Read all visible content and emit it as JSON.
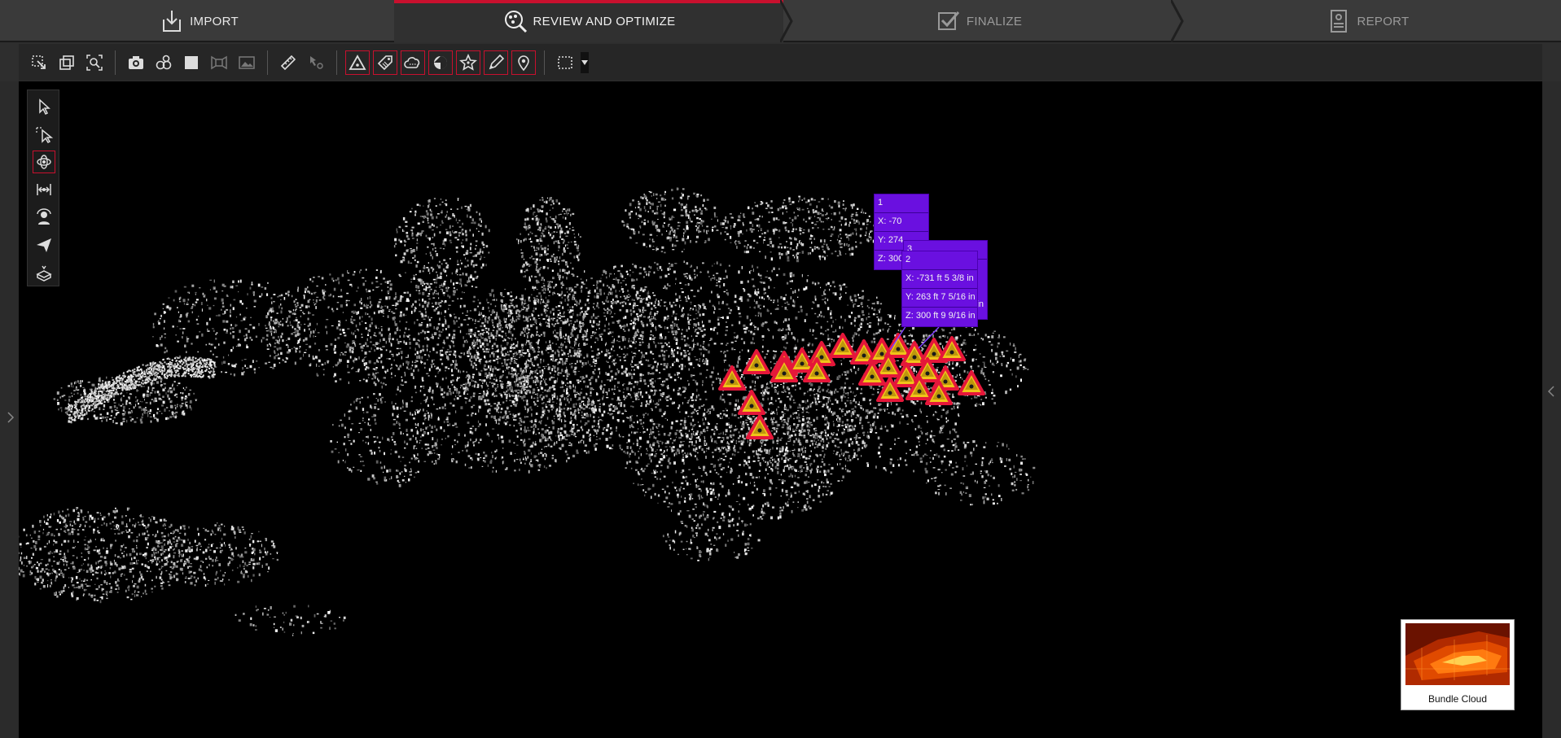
{
  "workflow": {
    "steps": [
      {
        "label": "IMPORT",
        "icon": "import-icon",
        "state": "done"
      },
      {
        "label": "REVIEW AND OPTIMIZE",
        "icon": "review-icon",
        "state": "active"
      },
      {
        "label": "FINALIZE",
        "icon": "finalize-icon",
        "state": "inactive"
      },
      {
        "label": "REPORT",
        "icon": "report-icon",
        "state": "inactive"
      }
    ],
    "active_color": "#c8102e"
  },
  "toolbar": {
    "groups": [
      [
        "fit-selection-icon",
        "clip-box-icon",
        "zoom-extents-icon"
      ],
      [
        "camera-icon",
        "scan-positions-icon",
        "box-view-icon",
        "panorama-view-icon",
        "image-icon"
      ],
      [
        "measure-icon",
        "pick-point-icon"
      ],
      [
        "warning-marker-icon",
        "tag-icon",
        "cloud-icon",
        "target-icon",
        "star-marker-icon",
        "pen-icon",
        "location-pin-icon"
      ],
      [
        "rect-select-icon"
      ]
    ]
  },
  "palette": {
    "tools": [
      "select-icon",
      "add-select-icon",
      "orbit-icon",
      "fit-width-icon",
      "walk-icon",
      "fly-icon",
      "clip-plane-icon"
    ],
    "active": "orbit-icon"
  },
  "labels": {
    "back_tag": {
      "row1": "1",
      "row2": "X: -70",
      "row3": "Y: 274",
      "row4": "Z: 300"
    },
    "tag3": {
      "row1": "3",
      "row_in": "in"
    },
    "front_tag": {
      "row1": "2",
      "row2": "X: -731 ft 5 3/8 in",
      "row3": "Y: 263 ft 7 5/16 in",
      "row4": "Z: 300 ft 9 9/16 in"
    }
  },
  "thumbnail": {
    "label": "Bundle Cloud"
  },
  "colors": {
    "label_bg": "#6a10e0",
    "marker_fill": "#f0c419",
    "marker_outline": "#e5173a"
  }
}
